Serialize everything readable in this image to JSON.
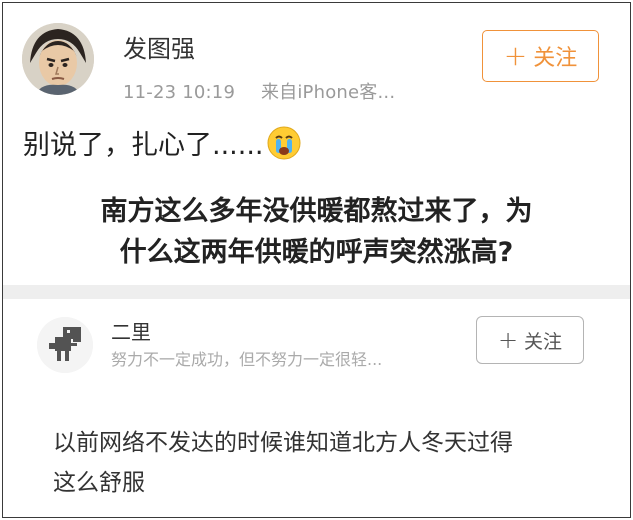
{
  "post": {
    "author": "发图强",
    "timestamp": "11-23 10:19",
    "source": "来自iPhone客...",
    "follow_label": "关注",
    "caption": "别说了，扎心了......",
    "caption_emoji": "crying-face-icon",
    "question_line1": "南方这么多年没供暖都熬过来了，为",
    "question_line2": "什么这两年供暖的呼声突然涨高?"
  },
  "reply": {
    "author": "二里",
    "bio": "努力不一定成功，但不努力一定很轻...",
    "follow_label": "关注",
    "avatar_icon": "dinosaur-icon",
    "body_line1": "以前网络不发达的时候谁知道北方人冬天过得",
    "body_line2": "这么舒服"
  },
  "colors": {
    "accent": "#f0923a",
    "meta_text": "#9a9a9a",
    "divider": "#eeeeee"
  }
}
